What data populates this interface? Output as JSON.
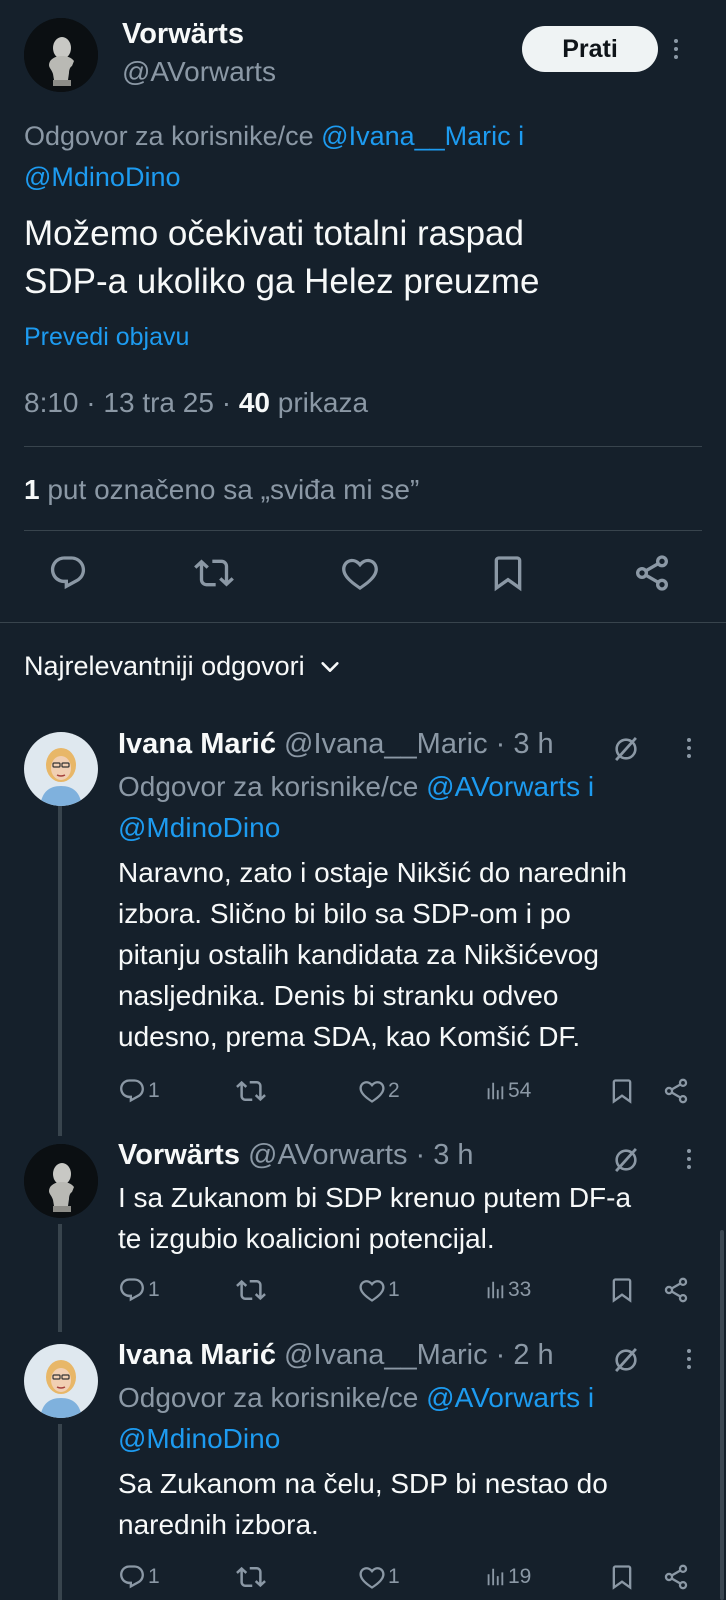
{
  "main_tweet": {
    "name": "Vorwärts",
    "handle": "@AVorwarts",
    "follow_label": "Prati",
    "reply_prefix": "Odgovor za korisnike/ce",
    "reply_user1": "@Ivana__Maric",
    "reply_and": "i",
    "reply_user2": "@MdinoDino",
    "text_line1": "Možemo očekivati totalni raspad",
    "text_line2": "SDP-a ukoliko ga Helez preuzme",
    "translate": "Prevedi objavu",
    "time": "8:10",
    "date": "13 tra 25",
    "views_count": "40",
    "views_label": "prikaza",
    "likes_count": "1",
    "likes_label": "put označeno sa „sviđa mi se”",
    "actions": [
      "reply-icon",
      "retweet-icon",
      "like-icon",
      "bookmark-icon",
      "share-icon"
    ]
  },
  "sort": {
    "label": "Najrelevantniji odgovori",
    "icon": "chevron-down-icon"
  },
  "replies": [
    {
      "name": "Ivana Marić",
      "handle": "@Ivana__Maric",
      "time": "3 h",
      "reply_prefix": "Odgovor za korisnike/ce",
      "reply_user1": "@AVorwarts",
      "reply_and": "i",
      "reply_user2": "@MdinoDino",
      "lines": [
        "Naravno, zato i ostaje Nikšić do narednih",
        "izbora. Slično bi bilo sa SDP-om i po",
        "pitanju ostalih kandidata za Nikšićevog",
        "nasljednika. Denis bi stranku odveo",
        "udesno, prema SDA, kao Komšić DF."
      ],
      "replies_count": "1",
      "retweets_count": "",
      "likes_count": "2",
      "views_count": "54"
    },
    {
      "name": "Vorwärts",
      "handle": "@AVorwarts",
      "time": "3 h",
      "lines": [
        "I sa Zukanom bi SDP krenuo putem DF-a",
        "te izgubio koalicioni potencijal."
      ],
      "replies_count": "1",
      "retweets_count": "",
      "likes_count": "1",
      "views_count": "33"
    },
    {
      "name": "Ivana Marić",
      "handle": "@Ivana__Maric",
      "time": "2 h",
      "reply_prefix": "Odgovor za korisnike/ce",
      "reply_user1": "@AVorwarts",
      "reply_and": "i",
      "reply_user2": "@MdinoDino",
      "lines": [
        "Sa Zukanom na čelu, SDP bi nestao do",
        "narednih izbora."
      ],
      "replies_count": "1",
      "retweets_count": "",
      "likes_count": "1",
      "views_count": "19"
    }
  ],
  "colors": {
    "background": "#15202b",
    "text": "#f7f9f9",
    "muted": "#8b98a5",
    "link": "#1d9bf0",
    "divider": "#38444d"
  }
}
